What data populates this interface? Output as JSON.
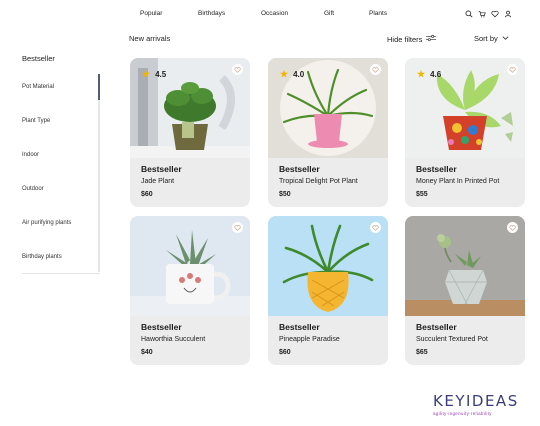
{
  "nav": {
    "items": [
      "Popular",
      "Birthdays",
      "Occasion",
      "Gift",
      "Plants"
    ],
    "icons": [
      "search-icon",
      "cart-icon",
      "heart-icon",
      "user-icon"
    ]
  },
  "subheader": {
    "title": "New arrivals",
    "hide_filters": "Hide filters",
    "sort_by": "Sort by"
  },
  "sidebar": {
    "title": "Bestseller",
    "filters": [
      "Pot Material",
      "Plant Type",
      "Indoor",
      "Outdoor",
      "Air purifying plants",
      "Birthday plants"
    ]
  },
  "products": [
    {
      "tag": "Bestseller",
      "name": "Jade Plant",
      "price": "$60",
      "rating": "4.5"
    },
    {
      "tag": "Bestseller",
      "name": "Tropical Delight Pot Plant",
      "price": "$50",
      "rating": "4.0"
    },
    {
      "tag": "Bestseller",
      "name": "Money Plant In Printed Pot",
      "price": "$55",
      "rating": "4.6"
    },
    {
      "tag": "Bestseller",
      "name": "Haworthia Succulent",
      "price": "$40",
      "rating": ""
    },
    {
      "tag": "Bestseller",
      "name": "Pineapple Paradise",
      "price": "$60",
      "rating": ""
    },
    {
      "tag": "Bestseller",
      "name": "Succulent Textured Pot",
      "price": "$65",
      "rating": ""
    }
  ],
  "brand": {
    "name": "KEYIDEAS",
    "tagline": "agility·ingenuity·reliability"
  },
  "colors": {
    "card_bg": "#ececec",
    "star": "#f2b400",
    "brand": "#3a3f7a",
    "brand_tag": "#9a3fb8"
  }
}
